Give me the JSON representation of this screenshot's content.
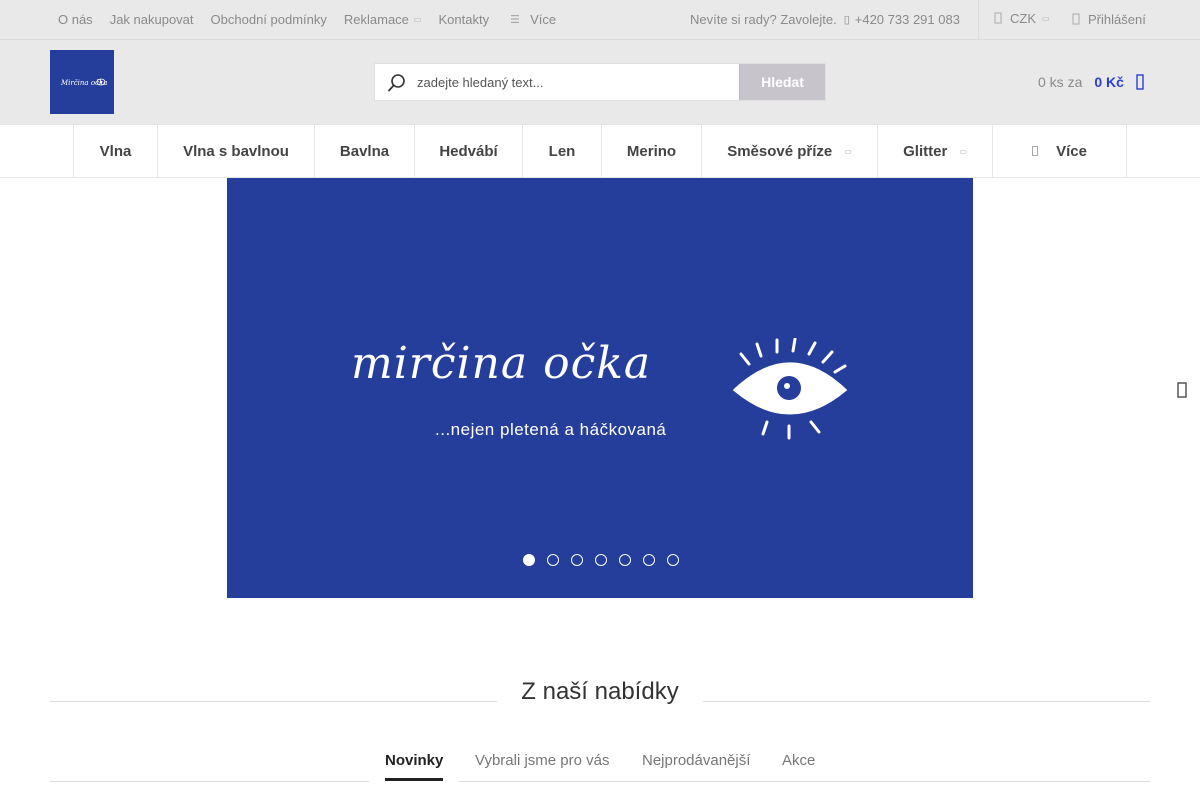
{
  "topbar": {
    "nav": [
      {
        "label": "O nás"
      },
      {
        "label": "Jak nakupovat"
      },
      {
        "label": "Obchodní podmínky"
      },
      {
        "label": "Reklamace",
        "has_caret": true
      },
      {
        "label": "Kontakty"
      },
      {
        "label": "Více",
        "icon": "bars-icon"
      }
    ],
    "help_text": "Nevíte si rady? Zavolejte.",
    "phone_icon": "phone-icon",
    "phone": "+420 733 291 083",
    "currency": "CZK",
    "currency_icon": "coins-icon",
    "login_label": "Přihlášení",
    "login_icon": "user-icon"
  },
  "header": {
    "logo_alt": "Mirčina očka",
    "search_placeholder": "zadejte hledaný text...",
    "search_button": "Hledat",
    "cart_qty": "0 ks za",
    "cart_price": "0 Kč",
    "cart_icon": "cart-icon"
  },
  "categories": [
    {
      "label": "Vlna"
    },
    {
      "label": "Vlna s bavlnou"
    },
    {
      "label": "Bavlna"
    },
    {
      "label": "Hedvábí"
    },
    {
      "label": "Len"
    },
    {
      "label": "Merino"
    },
    {
      "label": "Směsové příze",
      "has_caret": true
    },
    {
      "label": "Glitter",
      "has_caret": true
    },
    {
      "label": "Více",
      "icon": "bars-icon"
    }
  ],
  "banner": {
    "brand": "mirčina očka",
    "tagline": "...nejen pletená a háčkovaná",
    "slides": 7,
    "active_slide": 1,
    "bg_color": "#253d9b"
  },
  "offer": {
    "title": "Z naší nabídky",
    "tabs": [
      {
        "label": "Novinky",
        "active": true
      },
      {
        "label": "Vybrali jsme pro vás"
      },
      {
        "label": "Nejprodávanější"
      },
      {
        "label": "Akce"
      }
    ]
  },
  "colors": {
    "accent": "#2a3fd0",
    "brand_blue": "#253d9b",
    "topbar_bg": "#e9e9e9"
  }
}
